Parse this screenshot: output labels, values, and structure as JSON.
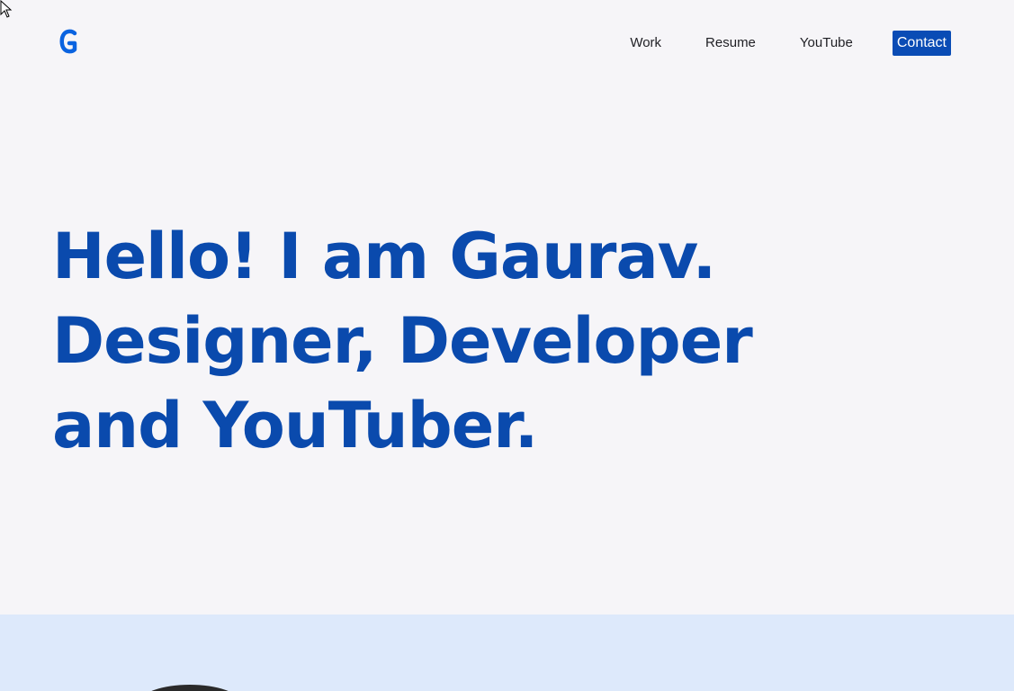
{
  "brand": {
    "logo_icon": "g-logo-icon",
    "accent_color": "#0a4cb5"
  },
  "nav": {
    "items": [
      {
        "label": "Work"
      },
      {
        "label": "Resume"
      },
      {
        "label": "YouTube"
      }
    ],
    "contact_label": "Contact"
  },
  "hero": {
    "lines": [
      "Hello! I am Gaurav.",
      "Designer, Developer",
      "and YouTuber."
    ],
    "text_color": "#0a4aad"
  },
  "section": {
    "background_color": "#dde9fb"
  }
}
